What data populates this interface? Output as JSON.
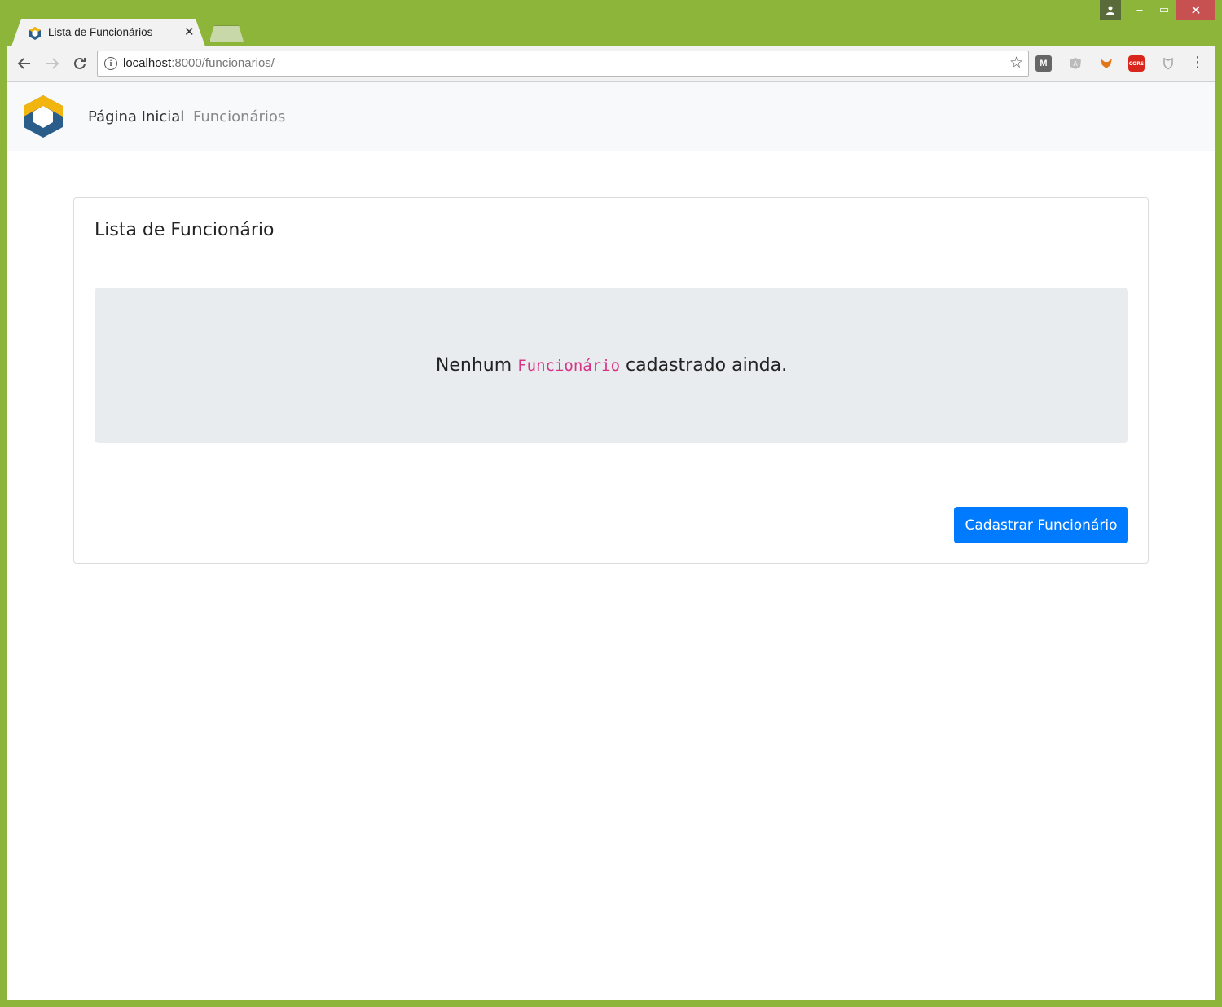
{
  "browser": {
    "tab": {
      "title": "Lista de Funcionários",
      "close_glyph": "✕"
    },
    "url": {
      "host": "localhost",
      "rest": ":8000/funcionarios/"
    },
    "extensions": {
      "m_label": "M",
      "cors_label": "CORS"
    },
    "window_controls": {
      "minimize": "‒",
      "maximize": "▭",
      "close": "✕"
    }
  },
  "navbar": {
    "links": [
      {
        "label": "Página Inicial"
      },
      {
        "label": "Funcionários"
      }
    ]
  },
  "card": {
    "title": "Lista de Funcionário",
    "empty_state": {
      "prefix": "Nenhum",
      "code": "Funcionário",
      "suffix": "cadastrado ainda."
    },
    "primary_button": "Cadastrar Funcionário"
  },
  "colors": {
    "frame": "#8db53a",
    "primary": "#007bff",
    "code": "#d63384",
    "jumbotron": "#e9ecef",
    "navbar": "#f8f9fa"
  }
}
